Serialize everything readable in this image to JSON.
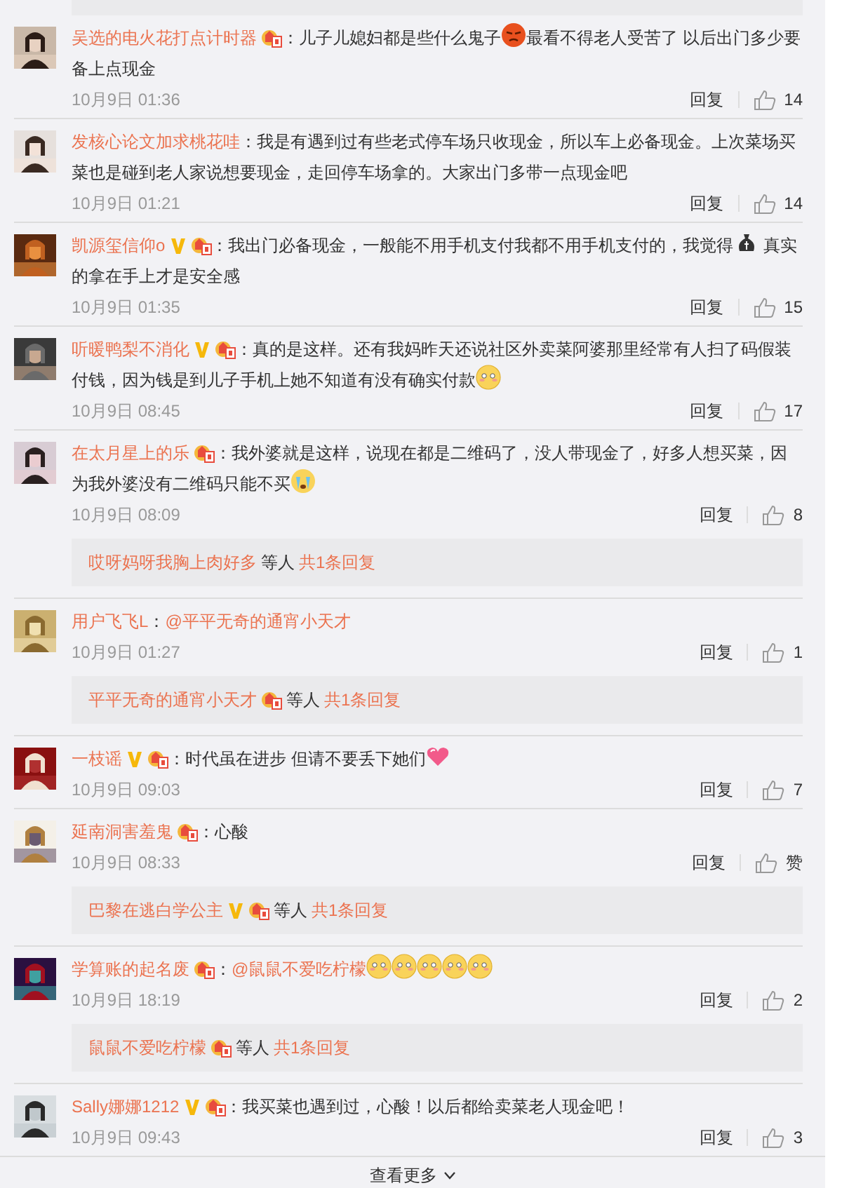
{
  "comments": [
    {
      "name": "吴选的电火花打点计时器",
      "verified": false,
      "badge": true,
      "body": [
        {
          "kind": "text",
          "text": "：儿子儿媳妇都是些什么鬼子"
        },
        {
          "kind": "angry"
        },
        {
          "kind": "text",
          "text": "最看不得老人受苦了 以后出门多少要备上点现金"
        }
      ],
      "time": "10月9日 01:36",
      "reply": "回复",
      "likes": "14"
    },
    {
      "name": "发核心论文加求桃花哇",
      "verified": false,
      "badge": false,
      "body": [
        {
          "kind": "text",
          "text": "：我是有遇到过有些老式停车场只收现金，所以车上必备现金。上次菜场买菜也是碰到老人家说想要现金，走回停车场拿的。大家出门多带一点现金吧"
        }
      ],
      "time": "10月9日 01:21",
      "reply": "回复",
      "likes": "14"
    },
    {
      "name": "凯源玺信仰o",
      "verified": true,
      "badge": true,
      "body": [
        {
          "kind": "text",
          "text": "：我出门必备现金，一般能不用手机支付我都不用手机支付的，我觉得"
        },
        {
          "kind": "moneybag"
        },
        {
          "kind": "text",
          "text": " 真实的拿在手上才是安全感"
        }
      ],
      "time": "10月9日 01:35",
      "reply": "回复",
      "likes": "15"
    },
    {
      "name": "听暖鸭梨不消化",
      "verified": true,
      "badge": true,
      "body": [
        {
          "kind": "text",
          "text": "：真的是这样。还有我妈昨天还说社区外卖菜阿婆那里经常有人扫了码假装付钱，因为钱是到儿子手机上她不知道有没有确实付款"
        },
        {
          "kind": "shy"
        }
      ],
      "time": "10月9日 08:45",
      "reply": "回复",
      "likes": "17"
    },
    {
      "name": "在太月星上的乐",
      "verified": false,
      "badge": true,
      "body": [
        {
          "kind": "text",
          "text": "：我外婆就是这样，说现在都是二维码了，没人带现金了，好多人想买菜，因为我外婆没有二维码只能不买"
        },
        {
          "kind": "cry"
        }
      ],
      "time": "10月9日 08:09",
      "reply": "回复",
      "likes": "8",
      "thread": {
        "name": "哎呀妈呀我胸上肉好多",
        "badge": false,
        "verified": false,
        "others": "等人",
        "count": "共1条回复"
      }
    },
    {
      "name": "用户飞飞L",
      "verified": false,
      "badge": false,
      "body": [
        {
          "kind": "text",
          "text": "："
        },
        {
          "kind": "mention",
          "text": "@平平无奇的通宵小天才"
        }
      ],
      "time": "10月9日 01:27",
      "reply": "回复",
      "likes": "1",
      "thread": {
        "name": "平平无奇的通宵小天才",
        "badge": true,
        "verified": false,
        "others": "等人",
        "count": "共1条回复"
      }
    },
    {
      "name": "一枝谣",
      "verified": true,
      "badge": true,
      "body": [
        {
          "kind": "text",
          "text": "：时代虽在进步 但请不要丢下她们"
        },
        {
          "kind": "heart"
        }
      ],
      "time": "10月9日 09:03",
      "reply": "回复",
      "likes": "7"
    },
    {
      "name": "延南洞害羞鬼",
      "verified": false,
      "badge": true,
      "body": [
        {
          "kind": "text",
          "text": "：心酸"
        }
      ],
      "time": "10月9日 08:33",
      "reply": "回复",
      "likes": "赞",
      "thread": {
        "name": "巴黎在逃白学公主",
        "badge": true,
        "verified": true,
        "others": "等人",
        "count": "共1条回复"
      }
    },
    {
      "name": "学算账的起名废",
      "verified": false,
      "badge": true,
      "body": [
        {
          "kind": "text",
          "text": "："
        },
        {
          "kind": "mention",
          "text": "@鼠鼠不爱吃柠檬"
        },
        {
          "kind": "shy"
        },
        {
          "kind": "shy"
        },
        {
          "kind": "shy"
        },
        {
          "kind": "shy"
        },
        {
          "kind": "shy"
        }
      ],
      "time": "10月9日 18:19",
      "reply": "回复",
      "likes": "2",
      "thread": {
        "name": "鼠鼠不爱吃柠檬",
        "badge": true,
        "verified": false,
        "others": "等人",
        "count": "共1条回复"
      }
    },
    {
      "name": "Sally娜娜1212",
      "verified": true,
      "badge": true,
      "body": [
        {
          "kind": "text",
          "text": "：我买菜也遇到过，心酸！以后都给卖菜老人现金吧！"
        }
      ],
      "time": "10月9日 09:43",
      "reply": "回复",
      "likes": "3"
    }
  ],
  "more": "查看更多"
}
